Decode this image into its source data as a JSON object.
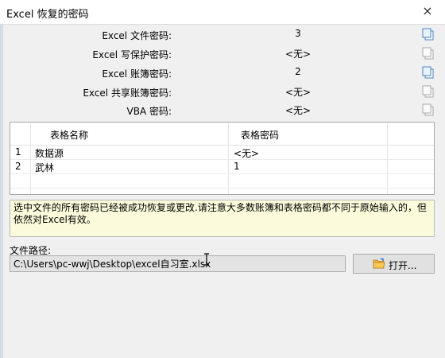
{
  "window": {
    "title": "Excel 恢复的密码",
    "close_glyph": "×"
  },
  "passwords": [
    {
      "label": "Excel 文件密码:",
      "value": "3"
    },
    {
      "label": "Excel 写保护密码:",
      "value": "<无>"
    },
    {
      "label": "Excel 账簿密码:",
      "value": "2"
    },
    {
      "label": "Excel 共享账簿密码:",
      "value": "<无>"
    },
    {
      "label": "VBA 密码:",
      "value": "<无>"
    }
  ],
  "copy_icons": [
    "copy-icon",
    "copy-icon",
    "copy-icon",
    "copy-icon",
    "copy-icon"
  ],
  "table": {
    "columns": [
      "表格名称",
      "表格密码"
    ],
    "rows": [
      {
        "num": "1",
        "name": "数据源",
        "password": "<无>"
      },
      {
        "num": "2",
        "name": "武林",
        "password": "1"
      }
    ]
  },
  "message": "选中文件的所有密码已经被成功恢复或更改.请注意大多数账簿和表格密码都不同于原始输入的，但依然对Excel有效。",
  "file_path": {
    "label": "文件路径:",
    "value": "C:\\Users\\pc-wwj\\Desktop\\excel自习室.xlsx"
  },
  "open_button": {
    "label": "打开...",
    "icon": "folder-icon"
  },
  "colors": {
    "message_bg": "#fbfbdc",
    "folder": "#f2b33d"
  }
}
